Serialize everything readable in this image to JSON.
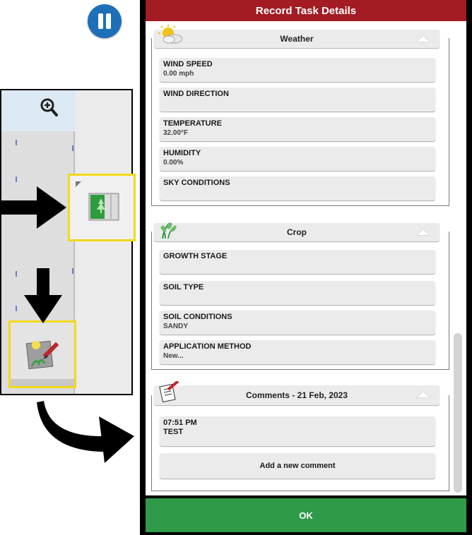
{
  "dialog": {
    "title": "Record Task Details",
    "ok_label": "OK"
  },
  "weather": {
    "header": "Weather",
    "icon": "weather-sun-cloud-icon",
    "fields": [
      {
        "label": "WIND SPEED",
        "value": "0.00 mph"
      },
      {
        "label": "WIND DIRECTION",
        "value": ""
      },
      {
        "label": "TEMPERATURE",
        "value": "32.00°F"
      },
      {
        "label": "HUMIDITY",
        "value": "0.00%"
      },
      {
        "label": "SKY CONDITIONS",
        "value": ""
      }
    ]
  },
  "crop": {
    "header": "Crop",
    "icon": "crop-plant-icon",
    "fields": [
      {
        "label": "GROWTH STAGE",
        "value": ""
      },
      {
        "label": "SOIL TYPE",
        "value": ""
      },
      {
        "label": "SOIL CONDITIONS",
        "value": "SANDY"
      },
      {
        "label": "APPLICATION METHOD",
        "value": "New..."
      }
    ]
  },
  "comments": {
    "header": "Comments - 21 Feb, 2023",
    "icon": "notepad-pen-icon",
    "items": [
      {
        "time": "07:51 PM",
        "text": "TEST"
      }
    ],
    "add_label": "Add a new comment"
  },
  "left_panel": {
    "zoom_icon": "zoom-in-icon",
    "pause_icon": "pause-icon",
    "highlight_1_icon": "field-map-icon",
    "highlight_2_icon": "record-notes-icon"
  },
  "colors": {
    "title_bar": "#a31c23",
    "ok_button": "#2f9a47",
    "pause_button": "#1d6fb8",
    "highlight_border": "#f2d91a"
  }
}
